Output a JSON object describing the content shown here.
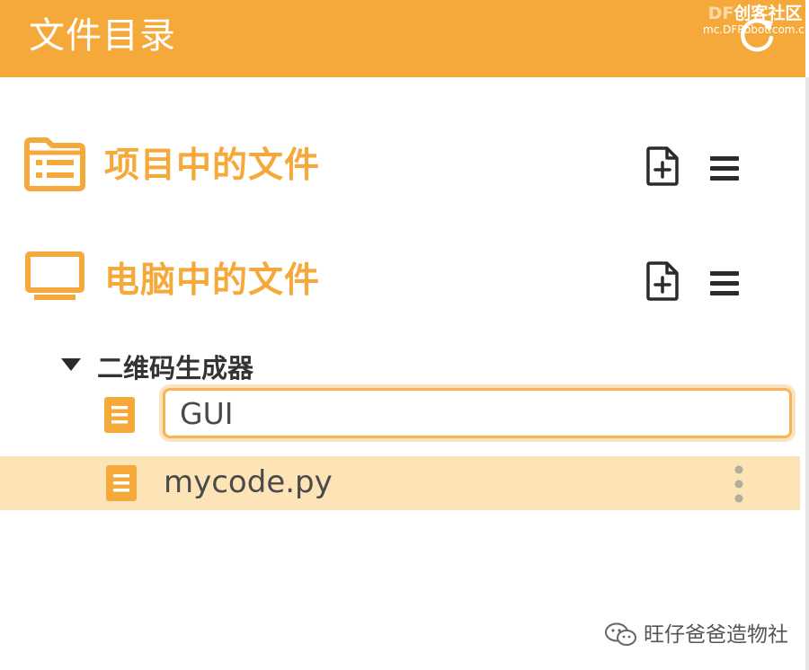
{
  "header": {
    "title": "文件目录",
    "refresh_icon": "refresh-icon"
  },
  "watermark_top": {
    "brand_df": "DF",
    "brand_rest": "创客社区",
    "url": "mc.DFRobot.com.cn"
  },
  "sections": [
    {
      "title": "项目中的文件",
      "icon": "folder-list-icon",
      "actions": [
        "new-file-icon",
        "menu-icon"
      ]
    },
    {
      "title": "电脑中的文件",
      "icon": "monitor-icon",
      "actions": [
        "new-file-icon",
        "menu-icon"
      ]
    }
  ],
  "tree": {
    "folder": {
      "label": "二维码生成器",
      "expanded": true
    },
    "rename_input": {
      "value": "GUI"
    },
    "file": {
      "name": "mycode.py"
    }
  },
  "watermark_bottom": {
    "text": "旺仔爸爸造物社"
  },
  "colors": {
    "accent": "#f5a93a",
    "selected_row": "#fde4b6",
    "icon_dark": "#2b2b2b",
    "text": "#4a4a4a"
  }
}
